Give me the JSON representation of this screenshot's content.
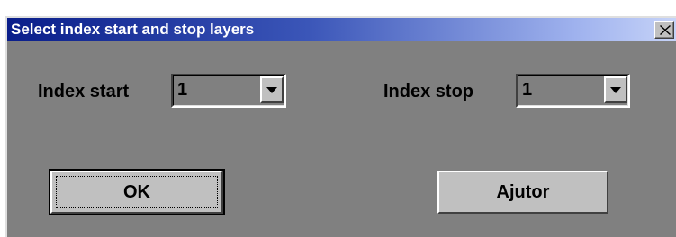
{
  "window": {
    "title": "Select index start and stop layers",
    "close_glyph": "✕"
  },
  "index_start": {
    "label": "Index start",
    "value": "1"
  },
  "index_stop": {
    "label": "Index stop",
    "value": "1"
  },
  "buttons": {
    "ok_label": "OK",
    "help_label": "Ajutor"
  },
  "colors": {
    "title_bar_start": "#0a1e8a",
    "title_bar_end": "#c6d3f8",
    "dialog_background": "#808080",
    "button_face": "#c0c0c0"
  }
}
